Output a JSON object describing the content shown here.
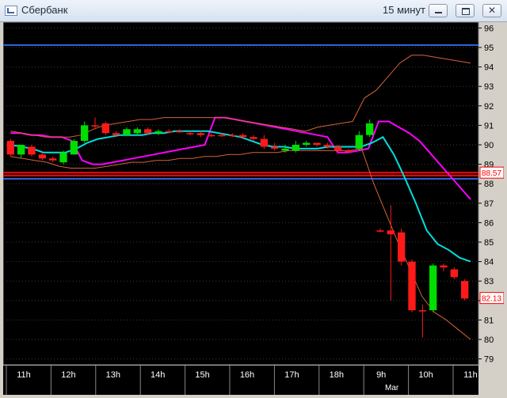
{
  "window": {
    "title": "Сбербанк",
    "timeframe": "15 минут"
  },
  "chart_data": {
    "type": "candlestick",
    "background": "#000000",
    "y_range": [
      78.7,
      96.3
    ],
    "y_ticks": [
      "96",
      "95",
      "94",
      "93",
      "92",
      "91",
      "90",
      "89",
      "88",
      "87",
      "86",
      "85",
      "84",
      "83",
      "82",
      "81",
      "80",
      "79"
    ],
    "x_labels": [
      "11h",
      "12h",
      "13h",
      "14h",
      "15h",
      "16h",
      "17h",
      "18h",
      "9h",
      "10h",
      "11h"
    ],
    "x_sub_label": "Mar",
    "last_price_labels": [
      "88.57",
      "82.13"
    ],
    "horizontal_lines": [
      {
        "value": 95.12,
        "color": "#2f62d8"
      },
      {
        "value": 88.57,
        "color": "#ff0000"
      },
      {
        "value": 88.42,
        "color": "#ff0000"
      },
      {
        "value": 88.25,
        "color": "#2f62d8"
      }
    ],
    "candles": [
      {
        "o": 90.2,
        "h": 90.3,
        "l": 89.4,
        "c": 89.5,
        "color": "red"
      },
      {
        "o": 89.5,
        "h": 90.0,
        "l": 89.3,
        "c": 90.0,
        "color": "green"
      },
      {
        "o": 89.9,
        "h": 90.0,
        "l": 89.4,
        "c": 89.5,
        "color": "red"
      },
      {
        "o": 89.5,
        "h": 89.6,
        "l": 89.2,
        "c": 89.3,
        "color": "red"
      },
      {
        "o": 89.3,
        "h": 89.4,
        "l": 89.1,
        "c": 89.2,
        "color": "red"
      },
      {
        "o": 89.1,
        "h": 89.7,
        "l": 89.0,
        "c": 89.6,
        "color": "green"
      },
      {
        "o": 89.5,
        "h": 90.3,
        "l": 89.5,
        "c": 90.2,
        "color": "green"
      },
      {
        "o": 90.2,
        "h": 91.2,
        "l": 90.1,
        "c": 91.0,
        "color": "green"
      },
      {
        "o": 91.0,
        "h": 91.4,
        "l": 90.8,
        "c": 91.0,
        "color": "red"
      },
      {
        "o": 91.1,
        "h": 91.2,
        "l": 90.5,
        "c": 90.6,
        "color": "red"
      },
      {
        "o": 90.6,
        "h": 90.7,
        "l": 90.4,
        "c": 90.5,
        "color": "red"
      },
      {
        "o": 90.5,
        "h": 90.9,
        "l": 90.5,
        "c": 90.8,
        "color": "green"
      },
      {
        "o": 90.6,
        "h": 90.9,
        "l": 90.5,
        "c": 90.8,
        "color": "green"
      },
      {
        "o": 90.8,
        "h": 90.9,
        "l": 90.5,
        "c": 90.6,
        "color": "red"
      },
      {
        "o": 90.6,
        "h": 90.8,
        "l": 90.5,
        "c": 90.7,
        "color": "green"
      },
      {
        "o": 90.7,
        "h": 90.8,
        "l": 90.6,
        "c": 90.7,
        "color": "red"
      },
      {
        "o": 90.7,
        "h": 90.8,
        "l": 90.6,
        "c": 90.7,
        "color": "red"
      },
      {
        "o": 90.6,
        "h": 90.7,
        "l": 90.5,
        "c": 90.6,
        "color": "red"
      },
      {
        "o": 90.6,
        "h": 90.7,
        "l": 90.4,
        "c": 90.5,
        "color": "red"
      },
      {
        "o": 90.5,
        "h": 90.6,
        "l": 90.4,
        "c": 90.5,
        "color": "red"
      },
      {
        "o": 90.5,
        "h": 90.6,
        "l": 90.4,
        "c": 90.5,
        "color": "red"
      },
      {
        "o": 90.5,
        "h": 90.6,
        "l": 90.4,
        "c": 90.5,
        "color": "red"
      },
      {
        "o": 90.5,
        "h": 90.6,
        "l": 90.3,
        "c": 90.4,
        "color": "red"
      },
      {
        "o": 90.4,
        "h": 90.5,
        "l": 90.2,
        "c": 90.3,
        "color": "red"
      },
      {
        "o": 90.3,
        "h": 90.5,
        "l": 89.8,
        "c": 89.9,
        "color": "red"
      },
      {
        "o": 89.9,
        "h": 90.1,
        "l": 89.7,
        "c": 89.8,
        "color": "red"
      },
      {
        "o": 89.7,
        "h": 90.0,
        "l": 89.6,
        "c": 89.8,
        "color": "green"
      },
      {
        "o": 89.7,
        "h": 90.2,
        "l": 89.6,
        "c": 90.0,
        "color": "green"
      },
      {
        "o": 90.0,
        "h": 90.2,
        "l": 89.9,
        "c": 90.1,
        "color": "green"
      },
      {
        "o": 90.1,
        "h": 90.1,
        "l": 89.9,
        "c": 90.0,
        "color": "red"
      },
      {
        "o": 90.0,
        "h": 90.1,
        "l": 89.8,
        "c": 89.9,
        "color": "red"
      },
      {
        "o": 89.9,
        "h": 90.0,
        "l": 89.6,
        "c": 89.7,
        "color": "red"
      },
      {
        "o": 89.7,
        "h": 89.8,
        "l": 89.6,
        "c": 89.7,
        "color": "red"
      },
      {
        "o": 89.8,
        "h": 90.7,
        "l": 89.7,
        "c": 90.5,
        "color": "green"
      },
      {
        "o": 90.5,
        "h": 91.3,
        "l": 90.4,
        "c": 91.1,
        "color": "green"
      },
      {
        "o": 85.6,
        "h": 85.7,
        "l": 85.5,
        "c": 85.6,
        "color": "red"
      },
      {
        "o": 85.6,
        "h": 86.9,
        "l": 82.0,
        "c": 85.4,
        "color": "red"
      },
      {
        "o": 85.5,
        "h": 85.7,
        "l": 83.8,
        "c": 84.0,
        "color": "red"
      },
      {
        "o": 84.0,
        "h": 84.1,
        "l": 81.4,
        "c": 81.5,
        "color": "red"
      },
      {
        "o": 81.5,
        "h": 81.8,
        "l": 80.1,
        "c": 81.5,
        "color": "red"
      },
      {
        "o": 81.5,
        "h": 83.9,
        "l": 81.4,
        "c": 83.8,
        "color": "green"
      },
      {
        "o": 83.8,
        "h": 83.9,
        "l": 83.5,
        "c": 83.7,
        "color": "red"
      },
      {
        "o": 83.6,
        "h": 83.7,
        "l": 83.1,
        "c": 83.2,
        "color": "red"
      },
      {
        "o": 83.0,
        "h": 83.1,
        "l": 82.0,
        "c": 82.1,
        "color": "red"
      }
    ],
    "series": [
      {
        "color": "#ff00ff",
        "values": [
          90.6,
          90.6,
          90.5,
          90.5,
          90.4,
          90.4,
          90.2,
          89.2,
          89.0,
          89.0,
          89.1,
          89.2,
          89.3,
          89.4,
          89.5,
          89.6,
          89.7,
          89.8,
          89.9,
          90.0,
          91.4,
          91.4,
          91.3,
          91.2,
          91.1,
          91.0,
          90.9,
          90.8,
          90.7,
          90.6,
          90.5,
          90.4,
          89.6,
          89.6,
          89.7,
          89.8,
          91.2,
          91.2,
          90.9,
          90.6,
          90.2,
          89.6,
          89.0,
          88.4,
          87.8,
          87.2
        ]
      },
      {
        "color": "#00dede",
        "values": [
          90.0,
          89.9,
          89.8,
          89.6,
          89.6,
          89.6,
          89.8,
          90.1,
          90.3,
          90.4,
          90.5,
          90.5,
          90.5,
          90.6,
          90.6,
          90.7,
          90.7,
          90.7,
          90.7,
          90.6,
          90.5,
          90.4,
          90.2,
          90.0,
          89.9,
          89.9,
          89.8,
          89.8,
          89.8,
          89.9,
          89.9,
          89.9,
          89.9,
          90.1,
          90.4,
          89.5,
          88.3,
          87.0,
          85.6,
          84.9,
          84.6,
          84.2,
          84.0
        ]
      },
      {
        "color": "#d4623a",
        "values": [
          90.7,
          90.6,
          90.5,
          90.4,
          90.4,
          90.4,
          90.5,
          90.8,
          91.0,
          91.1,
          91.2,
          91.3,
          91.3,
          91.4,
          91.4,
          91.4,
          91.4,
          91.4,
          91.4,
          91.3,
          91.2,
          91.1,
          91.0,
          90.9,
          90.8,
          90.7,
          90.9,
          91.0,
          91.1,
          91.2,
          92.4,
          92.8,
          93.5,
          94.2,
          94.6,
          94.6,
          94.5,
          94.4,
          94.3,
          94.2
        ]
      },
      {
        "color": "#d4623a",
        "values": [
          89.4,
          89.3,
          89.2,
          89.1,
          88.9,
          88.8,
          88.8,
          88.8,
          88.9,
          89.0,
          89.1,
          89.1,
          89.2,
          89.2,
          89.3,
          89.3,
          89.4,
          89.4,
          89.5,
          89.5,
          89.6,
          89.6,
          89.6,
          89.7,
          89.7,
          89.7,
          89.7,
          89.7,
          89.7,
          89.8,
          88.0,
          86.5,
          85.0,
          83.6,
          82.2,
          81.4,
          81.0,
          80.5,
          80.0
        ]
      }
    ]
  }
}
